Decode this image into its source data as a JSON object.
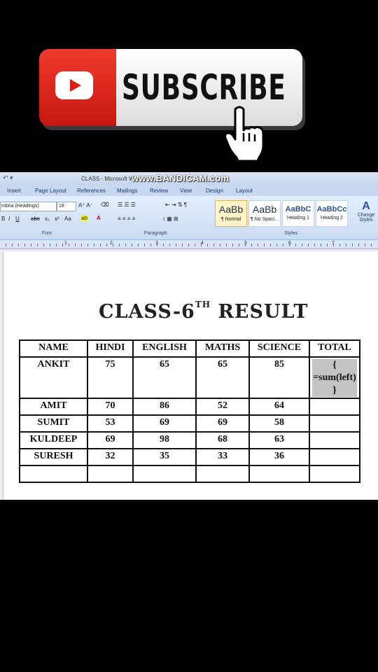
{
  "banner": {
    "subscribe_text": "SUBSCRIBE",
    "play_icon": "youtube-play-icon",
    "cursor_icon": "hand-pointer-icon"
  },
  "word": {
    "window_title": "CLASS - Microsoft W",
    "watermark": "www.BANDICAM.com",
    "tabs": [
      "Insert",
      "Page Layout",
      "References",
      "Mailings",
      "Review",
      "View",
      "Design",
      "Layout"
    ],
    "font_name": "mbria (Headings)",
    "font_size": "18",
    "groups": {
      "font": "Font",
      "paragraph": "Paragraph",
      "styles": "Styles"
    },
    "styles": [
      {
        "preview": "AaBb",
        "name": "¶ Normal"
      },
      {
        "preview": "AaBb",
        "name": "¶ No Spaci..."
      },
      {
        "preview": "AaBbC",
        "name": "Heading 1"
      },
      {
        "preview": "AaBbCc",
        "name": "Heading 2"
      }
    ],
    "change_styles": "Change Styles",
    "ruler_numbers": [
      "1",
      "2",
      "3",
      "4",
      "5",
      "6",
      "7"
    ]
  },
  "document": {
    "title_pre": "CLASS-6",
    "title_sup": "TH",
    "title_post": " RESULT",
    "headers": [
      "NAME",
      "HINDI",
      "ENGLISH",
      "MATHS",
      "SCIENCE",
      "TOTAL"
    ],
    "rows": [
      [
        "ANKIT",
        "75",
        "65",
        "65",
        "85",
        "{ =sum(left) }"
      ],
      [
        "AMIT",
        "70",
        "86",
        "52",
        "64",
        ""
      ],
      [
        "SUMIT",
        "53",
        "69",
        "69",
        "58",
        ""
      ],
      [
        "KULDEEP",
        "69",
        "98",
        "68",
        "63",
        ""
      ],
      [
        "SURESH",
        "32",
        "35",
        "33",
        "36",
        ""
      ],
      [
        "",
        "",
        "",
        "",
        "",
        ""
      ]
    ]
  }
}
